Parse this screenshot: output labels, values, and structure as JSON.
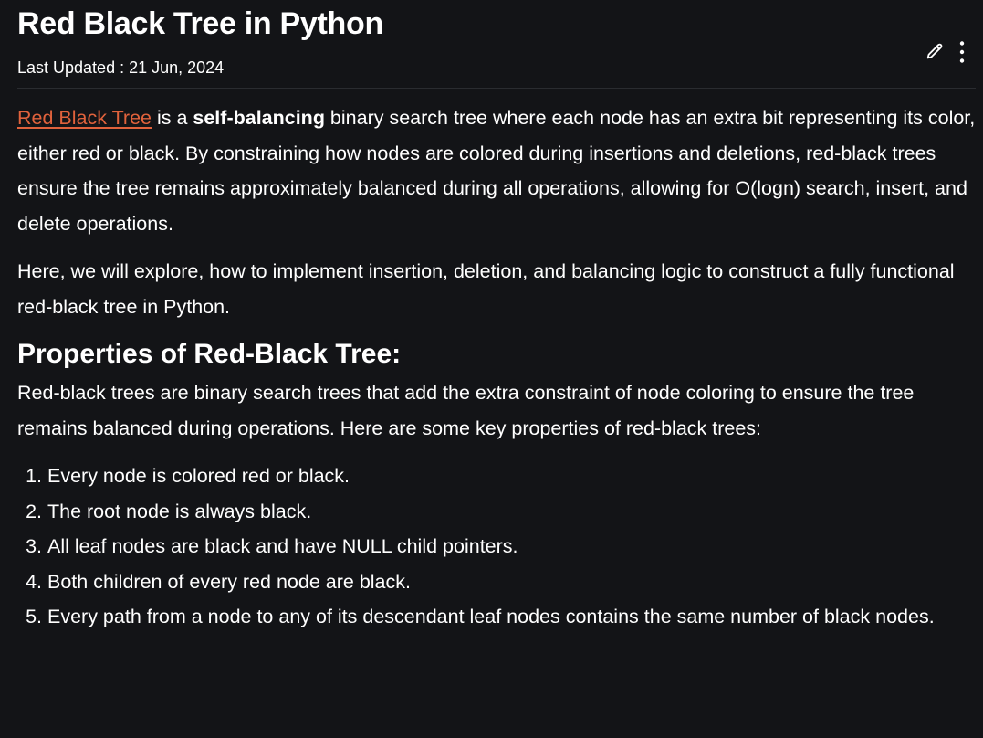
{
  "article": {
    "title": "Red Black Tree in Python",
    "last_updated": "Last Updated : 21 Jun, 2024"
  },
  "icons": {
    "edit": "pencil-icon",
    "more": "more-vertical-icon"
  },
  "intro": {
    "link_text": "Red Black Tree",
    "text_1": " is a ",
    "bold": "self-balancing",
    "text_2": " binary search tree where each node has an extra bit representing its color, either red or black. By constraining how nodes are colored during insertions and deletions, red-black trees ensure the tree remains approximately balanced during all operations, allowing for O(logn) search, insert, and delete operations."
  },
  "paragraph_2": "Here, we will explore, how to implement insertion, deletion, and balancing logic to construct a fully functional red-black tree in Python.",
  "properties": {
    "heading": "Properties of Red-Black Tree:",
    "description": "Red-black trees are binary search trees that add the extra constraint of node coloring to ensure the tree remains balanced during operations. Here are some key properties of red-black trees:",
    "items": [
      "Every node is colored red or black.",
      "The root node is always black.",
      "All leaf nodes are black and have NULL child pointers.",
      "Both children of every red node are black.",
      "Every path from a node to any of its descendant leaf nodes contains the same number of black nodes."
    ]
  },
  "colors": {
    "background": "#131417",
    "text": "#ffffff",
    "link": "#e0623c"
  }
}
